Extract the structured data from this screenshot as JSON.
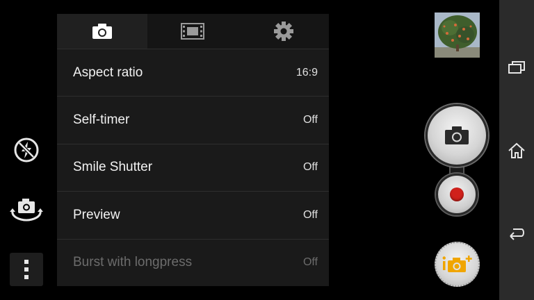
{
  "settings_tabs": [
    {
      "icon": "camera-icon",
      "active": true
    },
    {
      "icon": "film-strip-icon",
      "active": false
    },
    {
      "icon": "gear-icon",
      "active": false
    }
  ],
  "settings_rows": [
    {
      "label": "Aspect ratio",
      "value": "16:9",
      "enabled": true
    },
    {
      "label": "Self-timer",
      "value": "Off",
      "enabled": true
    },
    {
      "label": "Smile Shutter",
      "value": "Off",
      "enabled": true
    },
    {
      "label": "Preview",
      "value": "Off",
      "enabled": true
    },
    {
      "label": "Burst with longpress",
      "value": "Off",
      "enabled": false
    }
  ],
  "left_controls": {
    "flash_icon": "flash-off-icon",
    "switch_camera_icon": "switch-camera-icon",
    "menu_icon": "more-vertical-icon"
  },
  "right_controls": {
    "thumbnail": "last-photo-thumbnail",
    "shutter_icon": "camera-icon",
    "record_icon": "record-icon",
    "superior_auto_icon": "superior-auto-icon"
  },
  "navbar": {
    "recents_icon": "recents-icon",
    "home_icon": "home-icon",
    "back_icon": "back-icon"
  },
  "colors": {
    "record_red": "#d0211b",
    "superior_auto_orange": "#f0a500",
    "panel_bg": "#1a1a1a",
    "disabled_text": "#6c6c6c"
  }
}
